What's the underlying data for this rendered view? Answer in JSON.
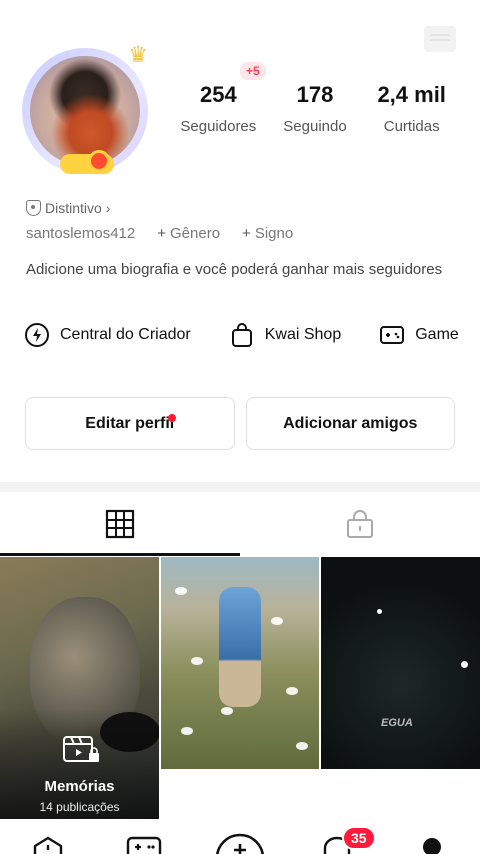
{
  "profile": {
    "username": "santoslemos412",
    "distintivo_label": "Distintivo",
    "gender_label": "Gênero",
    "sign_label": "Signo",
    "bio": "Adicione uma biografia e você poderá ganhar mais seguidores"
  },
  "stats": [
    {
      "value": "254",
      "label": "Seguidores",
      "badge": "+5"
    },
    {
      "value": "178",
      "label": "Seguindo"
    },
    {
      "value": "2,4 mil",
      "label": "Curtidas"
    }
  ],
  "shortcuts": [
    {
      "label": "Central do Criador",
      "icon": "lightning-icon"
    },
    {
      "label": "Kwai Shop",
      "icon": "shopping-bag-icon"
    },
    {
      "label": "Game",
      "icon": "gamepad-icon"
    }
  ],
  "buttons": {
    "edit_profile": "Editar perfil",
    "add_friends": "Adicionar amigos"
  },
  "tabs": [
    {
      "icon": "grid-icon",
      "active": true
    },
    {
      "icon": "lock-icon",
      "active": false
    }
  ],
  "memorias": {
    "title": "Memórias",
    "count": "14 publicações"
  },
  "cell3_watermark": "EGUA",
  "bottom_nav": {
    "notification_badge": "35"
  },
  "colors": {
    "accent_red": "#ff1a3c",
    "badge_pink_bg": "#ffe6ea"
  }
}
